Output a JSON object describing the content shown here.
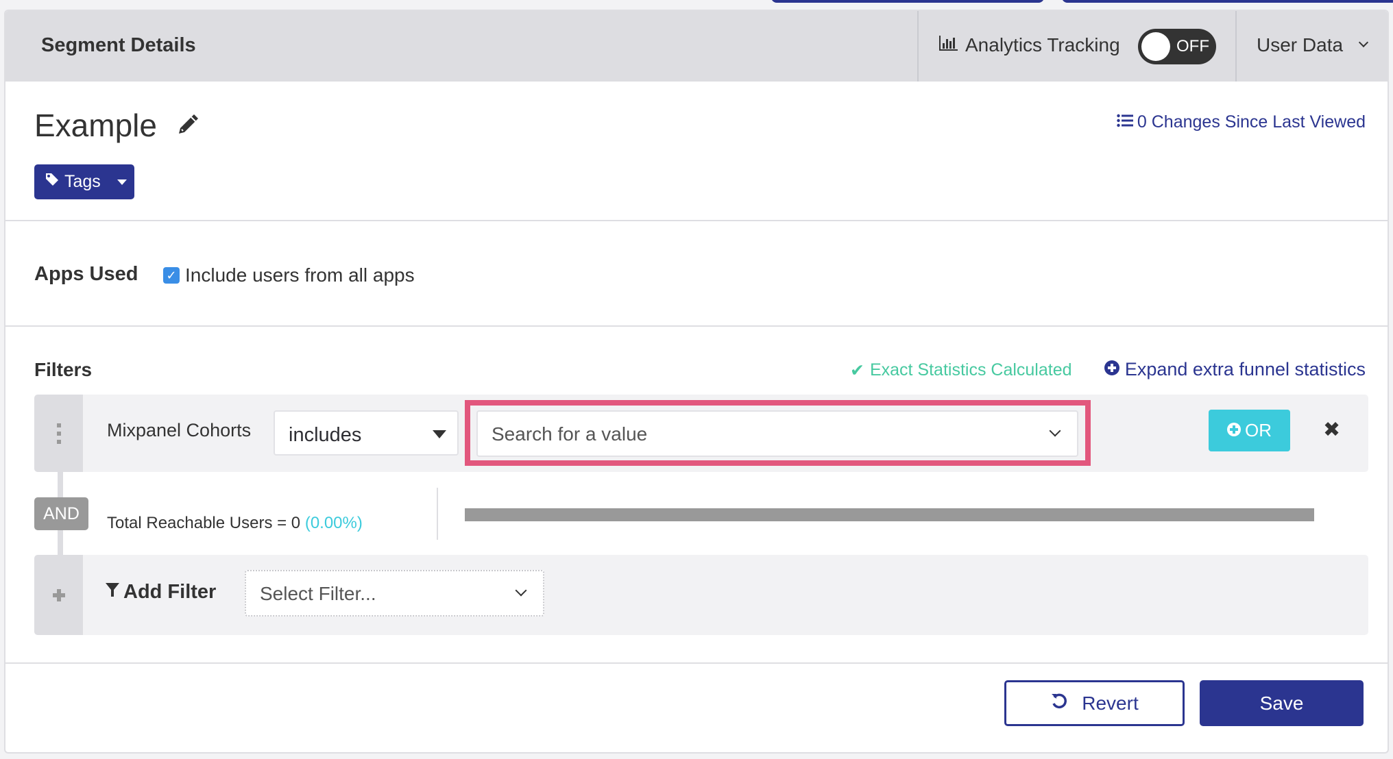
{
  "header": {
    "title": "Segment Details",
    "analytics_label": "Analytics Tracking",
    "analytics_toggle": "OFF",
    "user_data_label": "User Data"
  },
  "segment": {
    "name": "Example",
    "tags_label": "Tags",
    "changes_link": "0 Changes Since Last Viewed"
  },
  "apps": {
    "label": "Apps Used",
    "checkbox_label": "Include users from all apps",
    "checked": true
  },
  "filters": {
    "label": "Filters",
    "exact_status": "Exact Statistics Calculated",
    "expand_link": "Expand extra funnel statistics",
    "rows": [
      {
        "field": "Mixpanel Cohorts",
        "operator": "includes",
        "value_placeholder": "Search for a value",
        "or_label": "OR"
      }
    ],
    "and_label": "AND",
    "total_label": "Total Reachable Users = 0",
    "total_pct": "(0.00%)",
    "reach_fraction": 0,
    "add_filter_label": "Add Filter",
    "select_filter_placeholder": "Select Filter..."
  },
  "footer": {
    "revert_label": "Revert",
    "save_label": "Save"
  },
  "colors": {
    "brand": "#2b3590",
    "accent_cyan": "#3ccbdc",
    "success": "#47c9a0",
    "highlight": "#e2577d"
  }
}
